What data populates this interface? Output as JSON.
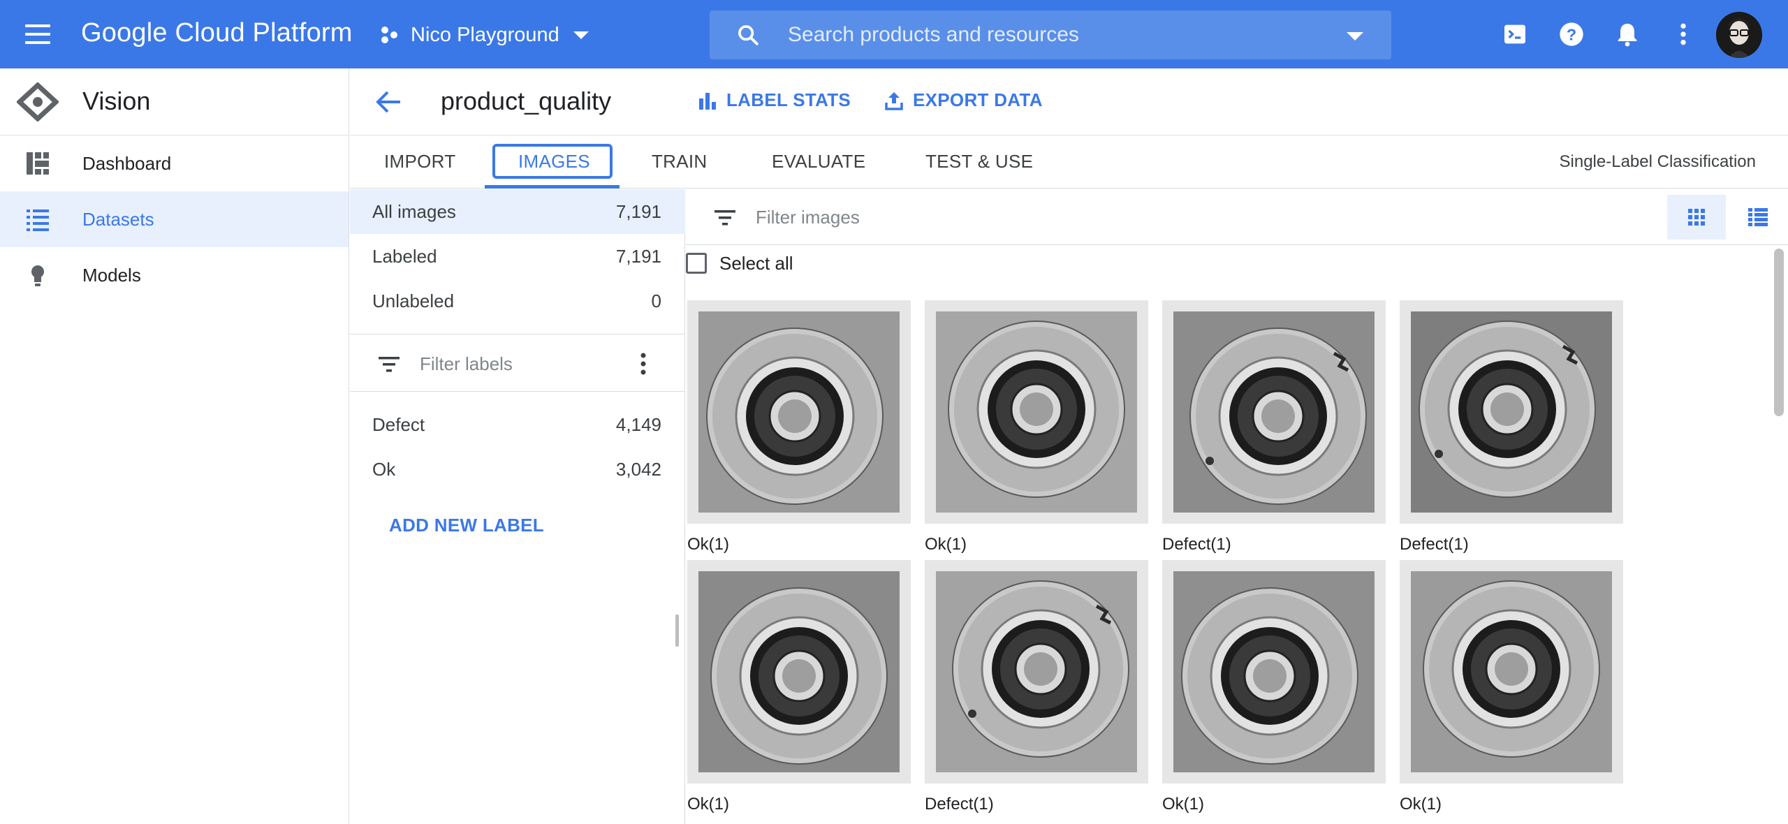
{
  "topbar": {
    "brand": "Google Cloud Platform",
    "project": "Nico Playground",
    "search_placeholder": "Search products and resources",
    "accent_color": "#3b78e7"
  },
  "leftnav": {
    "product_name": "Vision",
    "items": [
      {
        "label": "Dashboard",
        "icon": "dashboard-icon"
      },
      {
        "label": "Datasets",
        "icon": "list-icon",
        "active": true
      },
      {
        "label": "Models",
        "icon": "lightbulb-icon"
      }
    ]
  },
  "header": {
    "dataset_name": "product_quality",
    "label_stats": "LABEL STATS",
    "export_data": "EXPORT DATA"
  },
  "tabs": {
    "items": [
      "IMPORT",
      "IMAGES",
      "TRAIN",
      "EVALUATE",
      "TEST & USE"
    ],
    "active": "IMAGES",
    "mode": "Single-Label Classification"
  },
  "filters": {
    "all_images": {
      "label": "All images",
      "count": "7,191"
    },
    "labeled": {
      "label": "Labeled",
      "count": "7,191"
    },
    "unlabeled": {
      "label": "Unlabeled",
      "count": "0"
    },
    "filter_labels_placeholder": "Filter labels",
    "labels": [
      {
        "label": "Defect",
        "count": "4,149"
      },
      {
        "label": "Ok",
        "count": "3,042"
      }
    ],
    "add_new_label": "ADD NEW LABEL"
  },
  "images": {
    "filter_placeholder": "Filter images",
    "select_all": "Select all",
    "items": [
      {
        "label": "Ok(1)"
      },
      {
        "label": "Ok(1)"
      },
      {
        "label": "Defect(1)"
      },
      {
        "label": "Defect(1)"
      },
      {
        "label": "Ok(1)"
      },
      {
        "label": "Defect(1)"
      },
      {
        "label": "Ok(1)"
      },
      {
        "label": "Ok(1)"
      }
    ]
  }
}
